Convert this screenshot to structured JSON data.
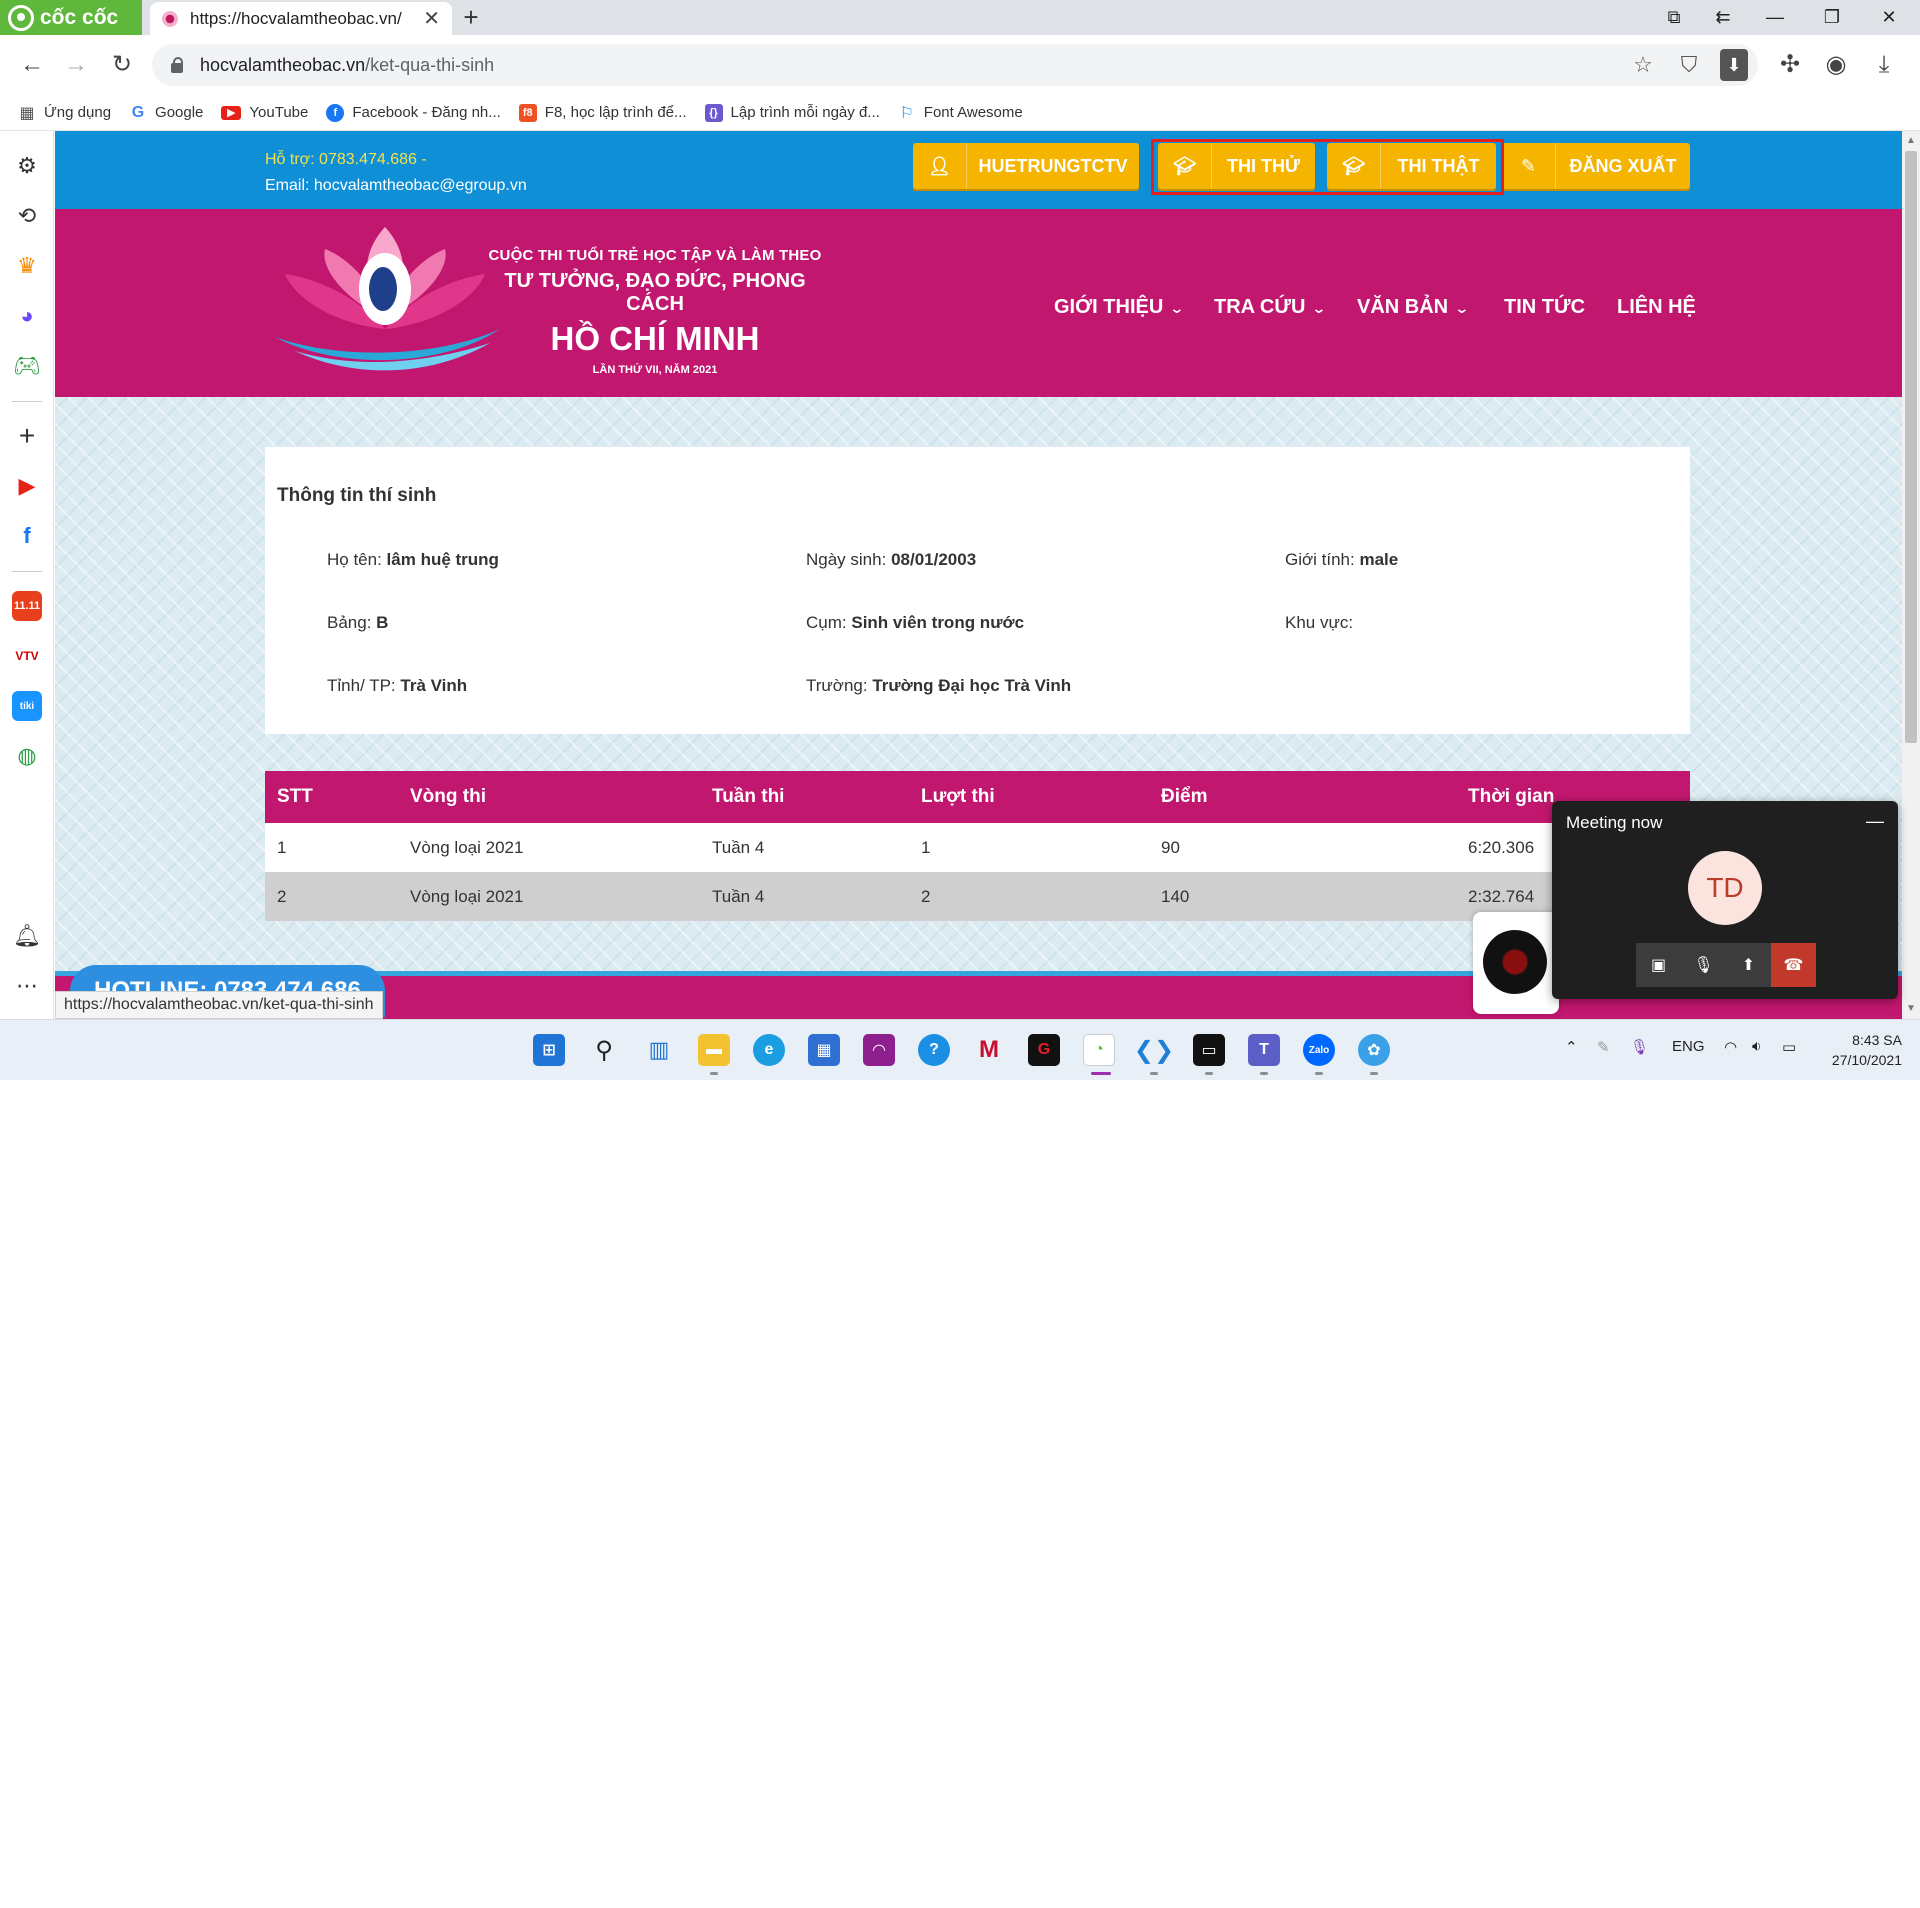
{
  "browser": {
    "brand": "cốc cốc",
    "tab_title": "https://hocvalamtheobac.vn/",
    "url_host": "hocvalamtheobac.vn",
    "url_path": "/ket-qua-thi-sinh",
    "status_url": "https://hocvalamtheobac.vn/ket-qua-thi-sinh",
    "bookmarks": [
      {
        "label": "Ứng dụng",
        "icon": "apps-grid-icon"
      },
      {
        "label": "Google",
        "icon": "google-icon"
      },
      {
        "label": "YouTube",
        "icon": "youtube-icon"
      },
      {
        "label": "Facebook - Đăng nh...",
        "icon": "facebook-icon"
      },
      {
        "label": "F8, học lập trình để...",
        "icon": "f8-icon"
      },
      {
        "label": "Lập trình mỗi ngày đ...",
        "icon": "code-icon"
      },
      {
        "label": "Font Awesome",
        "icon": "flag-icon"
      }
    ]
  },
  "site": {
    "support_phone": "Hỗ trợ: 0783.474.686 -",
    "support_email": "Email: hocvalamtheobac@egroup.vn",
    "user_button": "HUETRUNGTCTV",
    "trial_button": "THI THỬ",
    "real_button": "THI THẬT",
    "logout_button": "ĐĂNG XUẤT",
    "title_line1": "CUỘC THI TUỔI TRẺ HỌC TẬP VÀ LÀM THEO",
    "title_line2": "TƯ TƯỞNG, ĐẠO ĐỨC, PHONG CÁCH",
    "title_line3": "HỒ CHÍ MINH",
    "title_line4": "LẦN THỨ VII, NĂM 2021",
    "nav": [
      "GIỚI THIỆU",
      "TRA CỨU",
      "VĂN BẢN",
      "TIN TỨC",
      "LIÊN HỆ"
    ],
    "hotline": "HOTLINE: 0783.474.686"
  },
  "candidate": {
    "heading": "Thông tin thí sinh",
    "name_label": "Họ tên:",
    "name": "lâm huệ trung",
    "dob_label": "Ngày sinh:",
    "dob": "08/01/2003",
    "gender_label": "Giới tính:",
    "gender": "male",
    "board_label": "Bảng:",
    "board": "B",
    "cluster_label": "Cụm:",
    "cluster": "Sinh viên trong nước",
    "region_label": "Khu vực:",
    "region": "",
    "province_label": "Tỉnh/ TP:",
    "province": "Trà Vinh",
    "school_label": "Trường:",
    "school": "Trường Đại học Trà Vinh"
  },
  "results": {
    "headers": [
      "STT",
      "Vòng thi",
      "Tuần thi",
      "Lượt thi",
      "Điểm",
      "Thời gian"
    ],
    "rows": [
      [
        "1",
        "Vòng loại 2021",
        "Tuần 4",
        "1",
        "90",
        "6:20.306"
      ],
      [
        "2",
        "Vòng loại 2021",
        "Tuần 4",
        "2",
        "140",
        "2:32.764"
      ]
    ]
  },
  "meeting": {
    "title": "Meeting now",
    "initials": "TD"
  },
  "taskbar": {
    "lang": "ENG",
    "time": "8:43 SA",
    "date": "27/10/2021"
  },
  "colors": {
    "magenta": "#c2176f",
    "blue_strip": "#0f8fd6",
    "gold_button": "#f5b400",
    "highlight_box": "#e02020"
  }
}
